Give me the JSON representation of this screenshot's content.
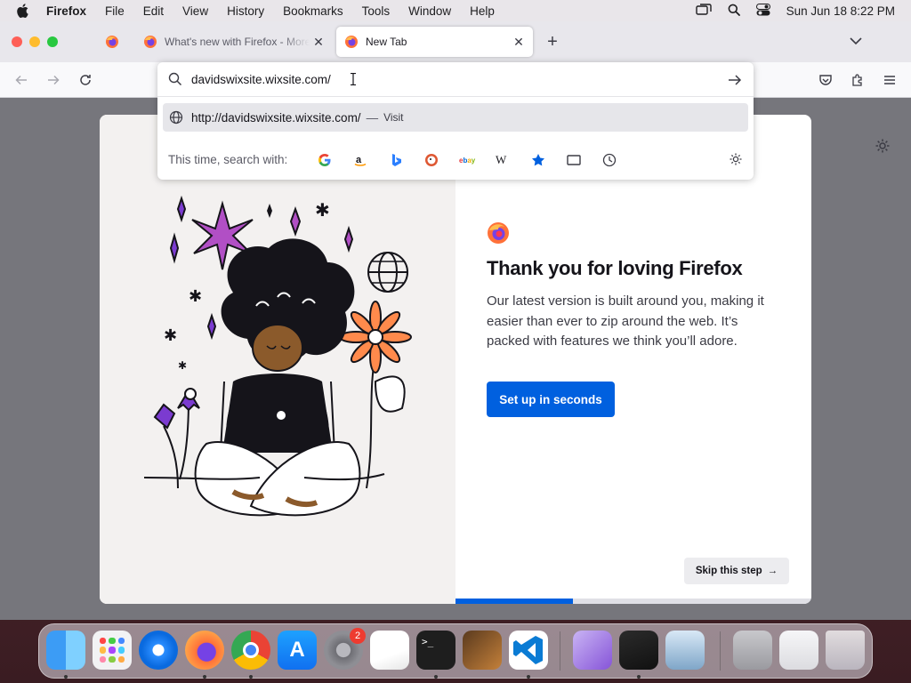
{
  "menubar": {
    "app_name": "Firefox",
    "items": [
      "File",
      "Edit",
      "View",
      "History",
      "Bookmarks",
      "Tools",
      "Window",
      "Help"
    ],
    "clock": "Sun Jun 18  8:22 PM"
  },
  "tabs": {
    "inactive_title": "What's new with Firefox - More",
    "active_title": "New Tab"
  },
  "urlbar": {
    "value": "davidswixsite.wixsite.com/",
    "suggestion_url": "http://davidswixsite.wixsite.com/",
    "suggestion_sep": "—",
    "suggestion_action": "Visit",
    "search_with_label": "This time, search with:",
    "engines": [
      "google-icon",
      "amazon-icon",
      "bing-icon",
      "duckduckgo-icon",
      "ebay-icon",
      "wikipedia-icon",
      "bookmarks-icon",
      "tabs-icon",
      "history-icon"
    ],
    "ebay_text": "ebay",
    "wiki_text": "W"
  },
  "onboarding": {
    "headline": "Thank you for loving Firefox",
    "body": "Our latest version is built around you, making it easier than ever to zip around the web. It’s packed with features we think you’ll adore.",
    "cta_label": "Set up in seconds",
    "skip_label": "Skip this step",
    "skip_arrow": "→",
    "progress": 0.33
  },
  "dock": {
    "settings_badge": "2",
    "apps": [
      "Finder",
      "Launchpad",
      "Safari",
      "Firefox",
      "Chrome",
      "App Store",
      "System Settings",
      "TextEdit",
      "Terminal",
      "Instruments",
      "VS Code",
      "Visual Studio",
      "Screenshot",
      "Preview",
      "Downloads",
      "Chrome Window",
      "Trash"
    ]
  },
  "colors": {
    "accent": "#0060df",
    "menubar_bg": "#e9e6ea",
    "tabbar_bg": "#e8e7ec"
  }
}
